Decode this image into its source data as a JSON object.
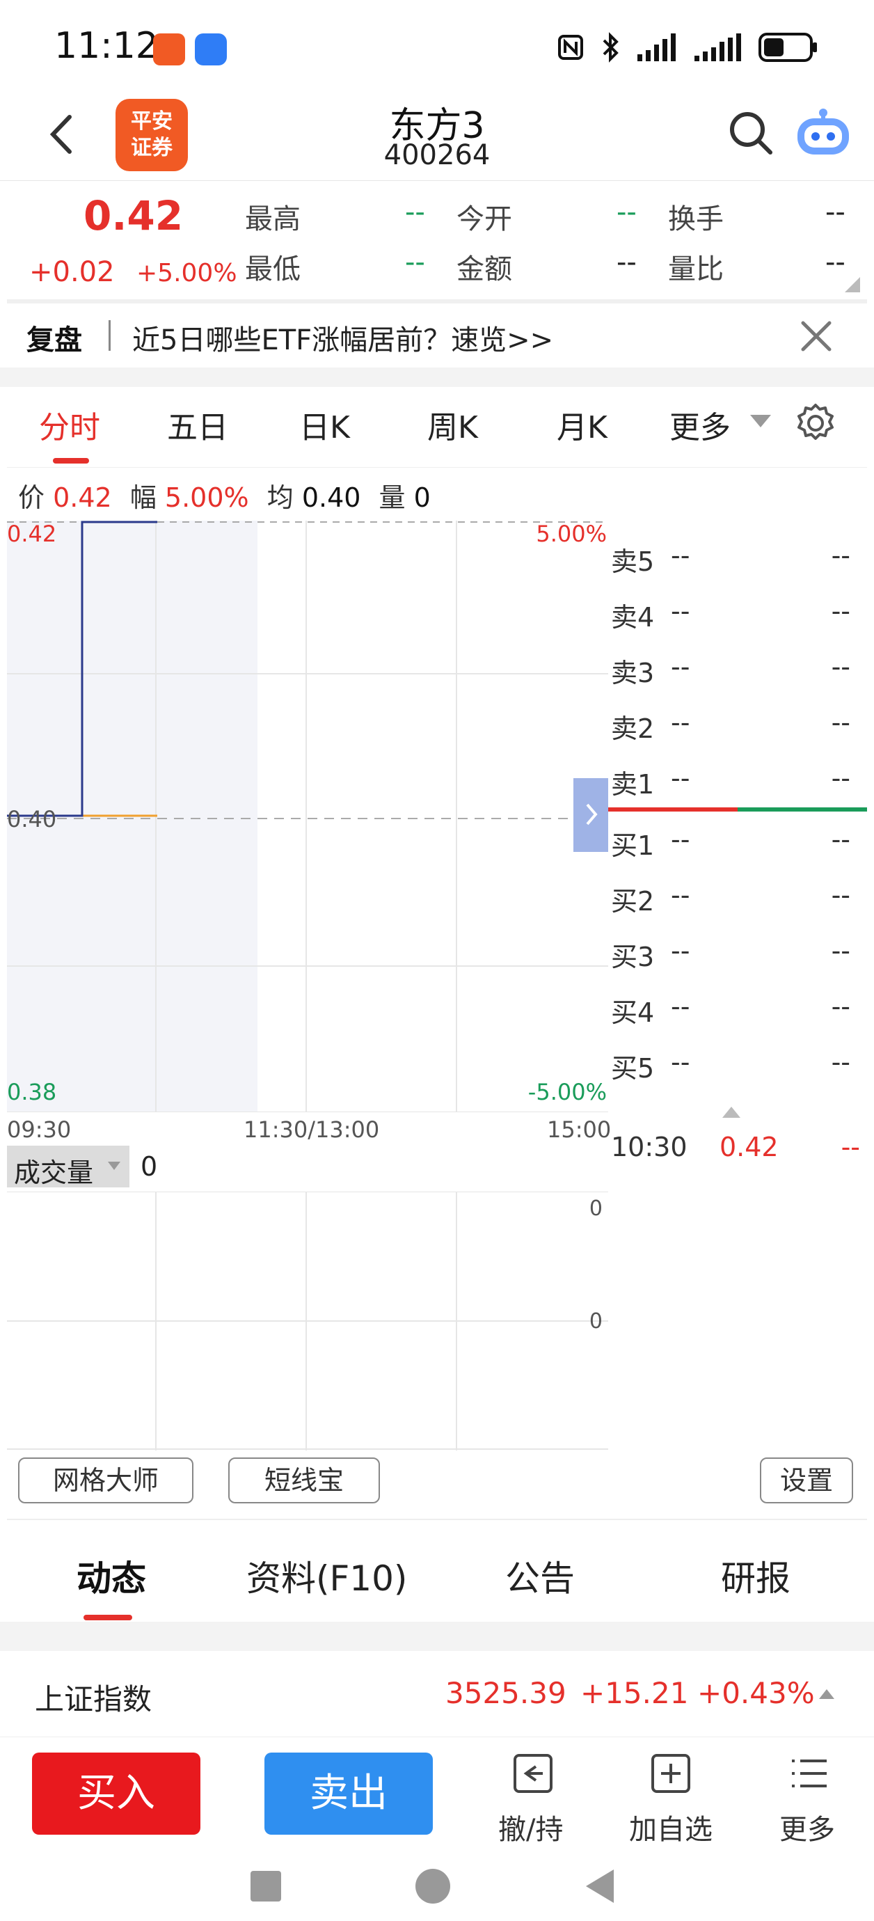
{
  "status_bar": {
    "time": "11:12"
  },
  "header": {
    "logo_text_line1": "平安",
    "logo_text_line2": "证券",
    "title": "东方3",
    "code": "400264"
  },
  "quote": {
    "price": "0.42",
    "change": "+0.02",
    "change_pct": "+5.00%",
    "fields": [
      {
        "label": "最高",
        "value": "--"
      },
      {
        "label": "今开",
        "value": "--"
      },
      {
        "label": "换手",
        "value": "--"
      },
      {
        "label": "最低",
        "value": "--"
      },
      {
        "label": "金额",
        "value": "--"
      },
      {
        "label": "量比",
        "value": "--"
      }
    ]
  },
  "banner": {
    "label": "复盘",
    "text": "近5日哪些ETF涨幅居前？速览>>"
  },
  "tabs": [
    "分时",
    "五日",
    "日K",
    "周K",
    "月K",
    "更多"
  ],
  "active_tab": 0,
  "info_line": {
    "price_label": "价",
    "price": "0.42",
    "amp_label": "幅",
    "amp": "5.00%",
    "avg_label": "均",
    "avg": "0.40",
    "vol_label": "量",
    "vol": "0"
  },
  "chart_data": {
    "type": "line",
    "y_left_ticks": [
      "0.42",
      "0.40",
      "0.38"
    ],
    "y_right_ticks": [
      "5.00%",
      "-5.00%"
    ],
    "x_ticks": [
      "09:30",
      "11:30/13:00",
      "15:00"
    ],
    "ylim": [
      0.38,
      0.42
    ],
    "series": [
      {
        "name": "价",
        "color": "#2b3a8c",
        "points": [
          [
            "09:30",
            0.4
          ],
          [
            "10:00",
            0.4
          ],
          [
            "10:00",
            0.42
          ],
          [
            "10:30",
            0.42
          ]
        ]
      },
      {
        "name": "均",
        "color": "#f0a030",
        "points": [
          [
            "10:00",
            0.4
          ],
          [
            "10:30",
            0.4
          ]
        ]
      }
    ],
    "prev_close": 0.4
  },
  "orderbook": {
    "sell": [
      {
        "label": "卖5",
        "price": "--",
        "vol": "--"
      },
      {
        "label": "卖4",
        "price": "--",
        "vol": "--"
      },
      {
        "label": "卖3",
        "price": "--",
        "vol": "--"
      },
      {
        "label": "卖2",
        "price": "--",
        "vol": "--"
      },
      {
        "label": "卖1",
        "price": "--",
        "vol": "--"
      }
    ],
    "buy": [
      {
        "label": "买1",
        "price": "--",
        "vol": "--"
      },
      {
        "label": "买2",
        "price": "--",
        "vol": "--"
      },
      {
        "label": "买3",
        "price": "--",
        "vol": "--"
      },
      {
        "label": "买4",
        "price": "--",
        "vol": "--"
      },
      {
        "label": "买5",
        "price": "--",
        "vol": "--"
      }
    ],
    "trade": {
      "time": "10:30",
      "price": "0.42",
      "vol": "--"
    }
  },
  "volume": {
    "label": "成交量",
    "value": "0",
    "ticks": [
      "0",
      "0"
    ]
  },
  "tools": {
    "grid_master": "网格大师",
    "short_line": "短线宝",
    "settings": "设置"
  },
  "bottom_tabs": [
    "动态",
    "资料(F10)",
    "公告",
    "研报"
  ],
  "index": {
    "name": "上证指数",
    "value": "3525.39",
    "change": "+15.21",
    "pct": "+0.43%"
  },
  "actions": {
    "buy": "买入",
    "sell": "卖出",
    "cancel": "撤/持",
    "watch": "加自选",
    "more": "更多"
  },
  "colors": {
    "up": "#e5302b",
    "down": "#1a9c5a",
    "buy_btn": "#e8191e",
    "sell_btn": "#2f8ff0",
    "brand": "#f15a24"
  }
}
